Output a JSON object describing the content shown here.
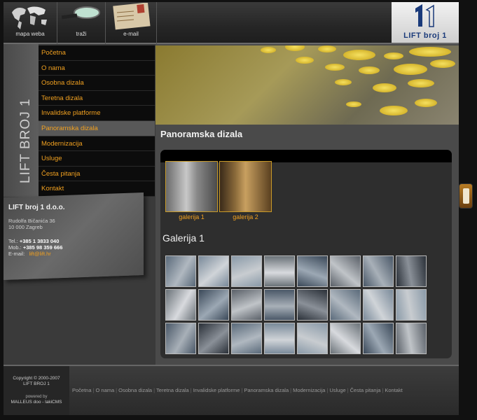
{
  "topbar": {
    "sitemap_label": "mapa weba",
    "search_label": "traži",
    "email_label": "e-mail",
    "logo_text": "LIFT broj 1"
  },
  "sidebar": {
    "vertical_title": "LIFT BROJ 1",
    "nav": [
      {
        "label": "Početna"
      },
      {
        "label": "O nama"
      },
      {
        "label": "Osobna dizala"
      },
      {
        "label": "Teretna dizala"
      },
      {
        "label": "Invalidske platforme"
      },
      {
        "label": "Panoramska dizala"
      },
      {
        "label": "Modernizacija"
      },
      {
        "label": "Usluge"
      },
      {
        "label": "Česta pitanja"
      },
      {
        "label": "Kontakt"
      }
    ],
    "active_index": 5,
    "contact": {
      "company": "LIFT broj 1 d.o.o.",
      "street": "Rudolfa Bičanića 36",
      "city": "10 000 Zagreb",
      "tel_label": "Tel.:",
      "tel": "+385 1 3833 040",
      "mob_label": "Mob.:",
      "mob": "+385 98 359 666",
      "email_label": "E-mail:",
      "email": "lift@lift.hr"
    }
  },
  "main": {
    "page_title": "Panoramska dizala",
    "albums": [
      {
        "caption": "galerija 1"
      },
      {
        "caption": "galerija 2"
      }
    ],
    "gallery_heading": "Galerija 1"
  },
  "footer": {
    "copyright": "Copyright © 2000-2007",
    "owner": "LIFT BROJ 1",
    "powered_by": "powered by",
    "powered_name": "MALLEUS doo - lakiCMS",
    "links": [
      "Početna",
      "O nama",
      "Osobna dizala",
      "Teretna dizala",
      "Invalidske platforme",
      "Panoramska dizala",
      "Modernizacija",
      "Usluge",
      "Česta pitanja",
      "Kontakt"
    ]
  },
  "colors": {
    "accent": "#f0a020",
    "logo_blue": "#1a3a7a"
  }
}
